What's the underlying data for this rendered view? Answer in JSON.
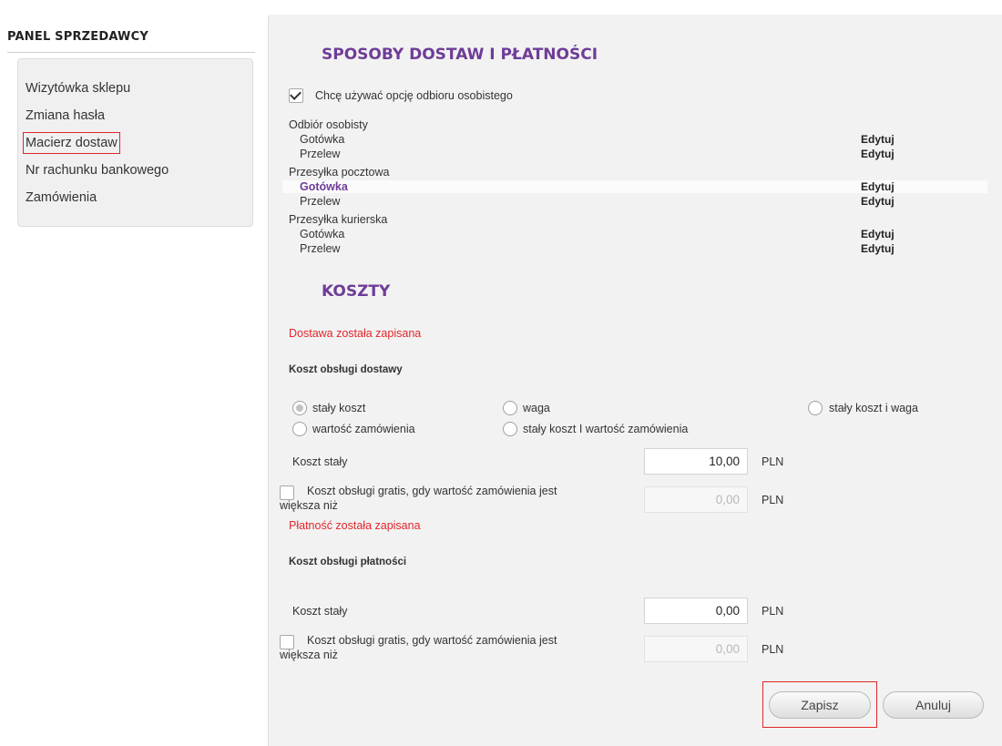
{
  "sidebar": {
    "title": "PANEL SPRZEDAWCY",
    "items": [
      {
        "label": "Wizytówka sklepu"
      },
      {
        "label": "Zmiana hasła"
      },
      {
        "label": "Macierz dostaw"
      },
      {
        "label": "Nr rachunku bankowego"
      },
      {
        "label": "Zamówienia"
      }
    ]
  },
  "delivery": {
    "title": "SPOSOBY DOSTAW I PŁATNOŚCI",
    "pickup_checkbox_label": "Chcę używać opcję odbioru osobistego",
    "edit_label": "Edytuj",
    "groups": [
      {
        "name": "Odbiór osobisty",
        "items": [
          "Gotówka",
          "Przelew"
        ]
      },
      {
        "name": "Przesyłka pocztowa",
        "items": [
          "Gotówka",
          "Przelew"
        ]
      },
      {
        "name": "Przesyłka kurierska",
        "items": [
          "Gotówka",
          "Przelew"
        ]
      }
    ]
  },
  "costs": {
    "title": "KOSZTY",
    "delivery_saved_msg": "Dostawa została zapisana",
    "delivery_cost_label": "Koszt obsługi dostawy",
    "radio_options": {
      "fixed": "stały koszt",
      "weight": "waga",
      "fixed_weight": "stały koszt i waga",
      "order_value": "wartość zamówienia",
      "fixed_order_value": "stały koszt I wartość zamówienia"
    },
    "fixed_cost_label": "Koszt stały",
    "currency": "PLN",
    "delivery_fixed_value": "10,00",
    "free_label_line1": "Koszt obsługi gratis, gdy wartość zamówienia jest",
    "free_label_line2": "większa niż",
    "delivery_free_value": "0,00",
    "payment_saved_msg": "Płatność została zapisana",
    "payment_cost_label": "Koszt obsługi płatności",
    "payment_fixed_value": "0,00",
    "payment_free_value": "0,00"
  },
  "buttons": {
    "save": "Zapisz",
    "cancel": "Anuluj"
  },
  "colors": {
    "accent_purple": "#6f3c98",
    "message_red": "#e3262b",
    "highlight_red": "#e0262b"
  }
}
